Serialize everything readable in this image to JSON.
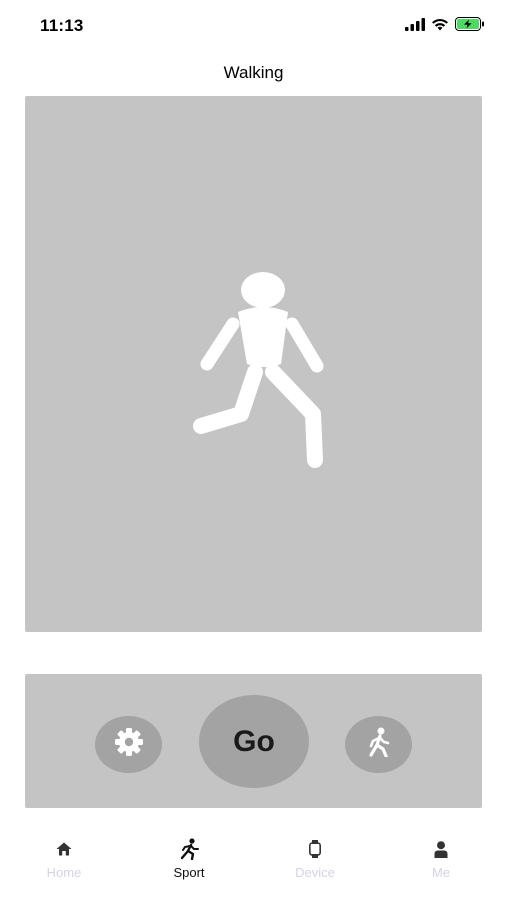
{
  "status_bar": {
    "time": "11:13",
    "icons": [
      "cellular-signal-icon",
      "wifi-icon",
      "battery-charging-icon"
    ]
  },
  "header": {
    "title": "Walking"
  },
  "preview": {
    "icon": "walking-person-icon"
  },
  "controls": {
    "settings_icon": "gear-icon",
    "go_label": "Go",
    "mode_icon": "walking-icon"
  },
  "tab_bar": {
    "active": "Sport",
    "tabs": [
      {
        "label": "Home",
        "icon": "home-icon"
      },
      {
        "label": "Sport",
        "icon": "running-icon"
      },
      {
        "label": "Device",
        "icon": "watch-icon"
      },
      {
        "label": "Me",
        "icon": "person-icon"
      }
    ]
  },
  "colors": {
    "panel": "#c4c4c4",
    "button": "#a3a3a3",
    "inactive_tab": "#d4d4e4",
    "battery": "#4cd964"
  }
}
